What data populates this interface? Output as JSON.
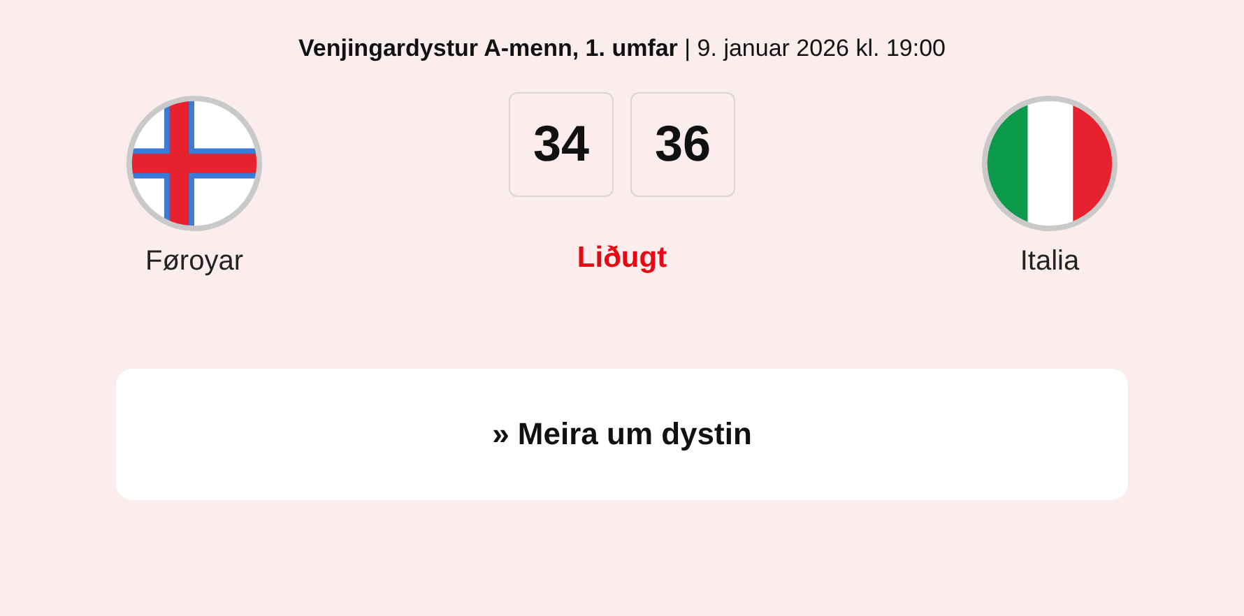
{
  "header": "**Venjingardystur A-menn, 1. umfar** | 9. januar 2026 kl. 19:00",
  "home": {
    "name": "Føroyar",
    "kind": "faroe"
  },
  "away": {
    "name": "Italia",
    "kind": "italy"
  },
  "score": [
    "34",
    "36"
  ],
  "status": "Liðugt",
  "more_button": "» Meira um dystin"
}
